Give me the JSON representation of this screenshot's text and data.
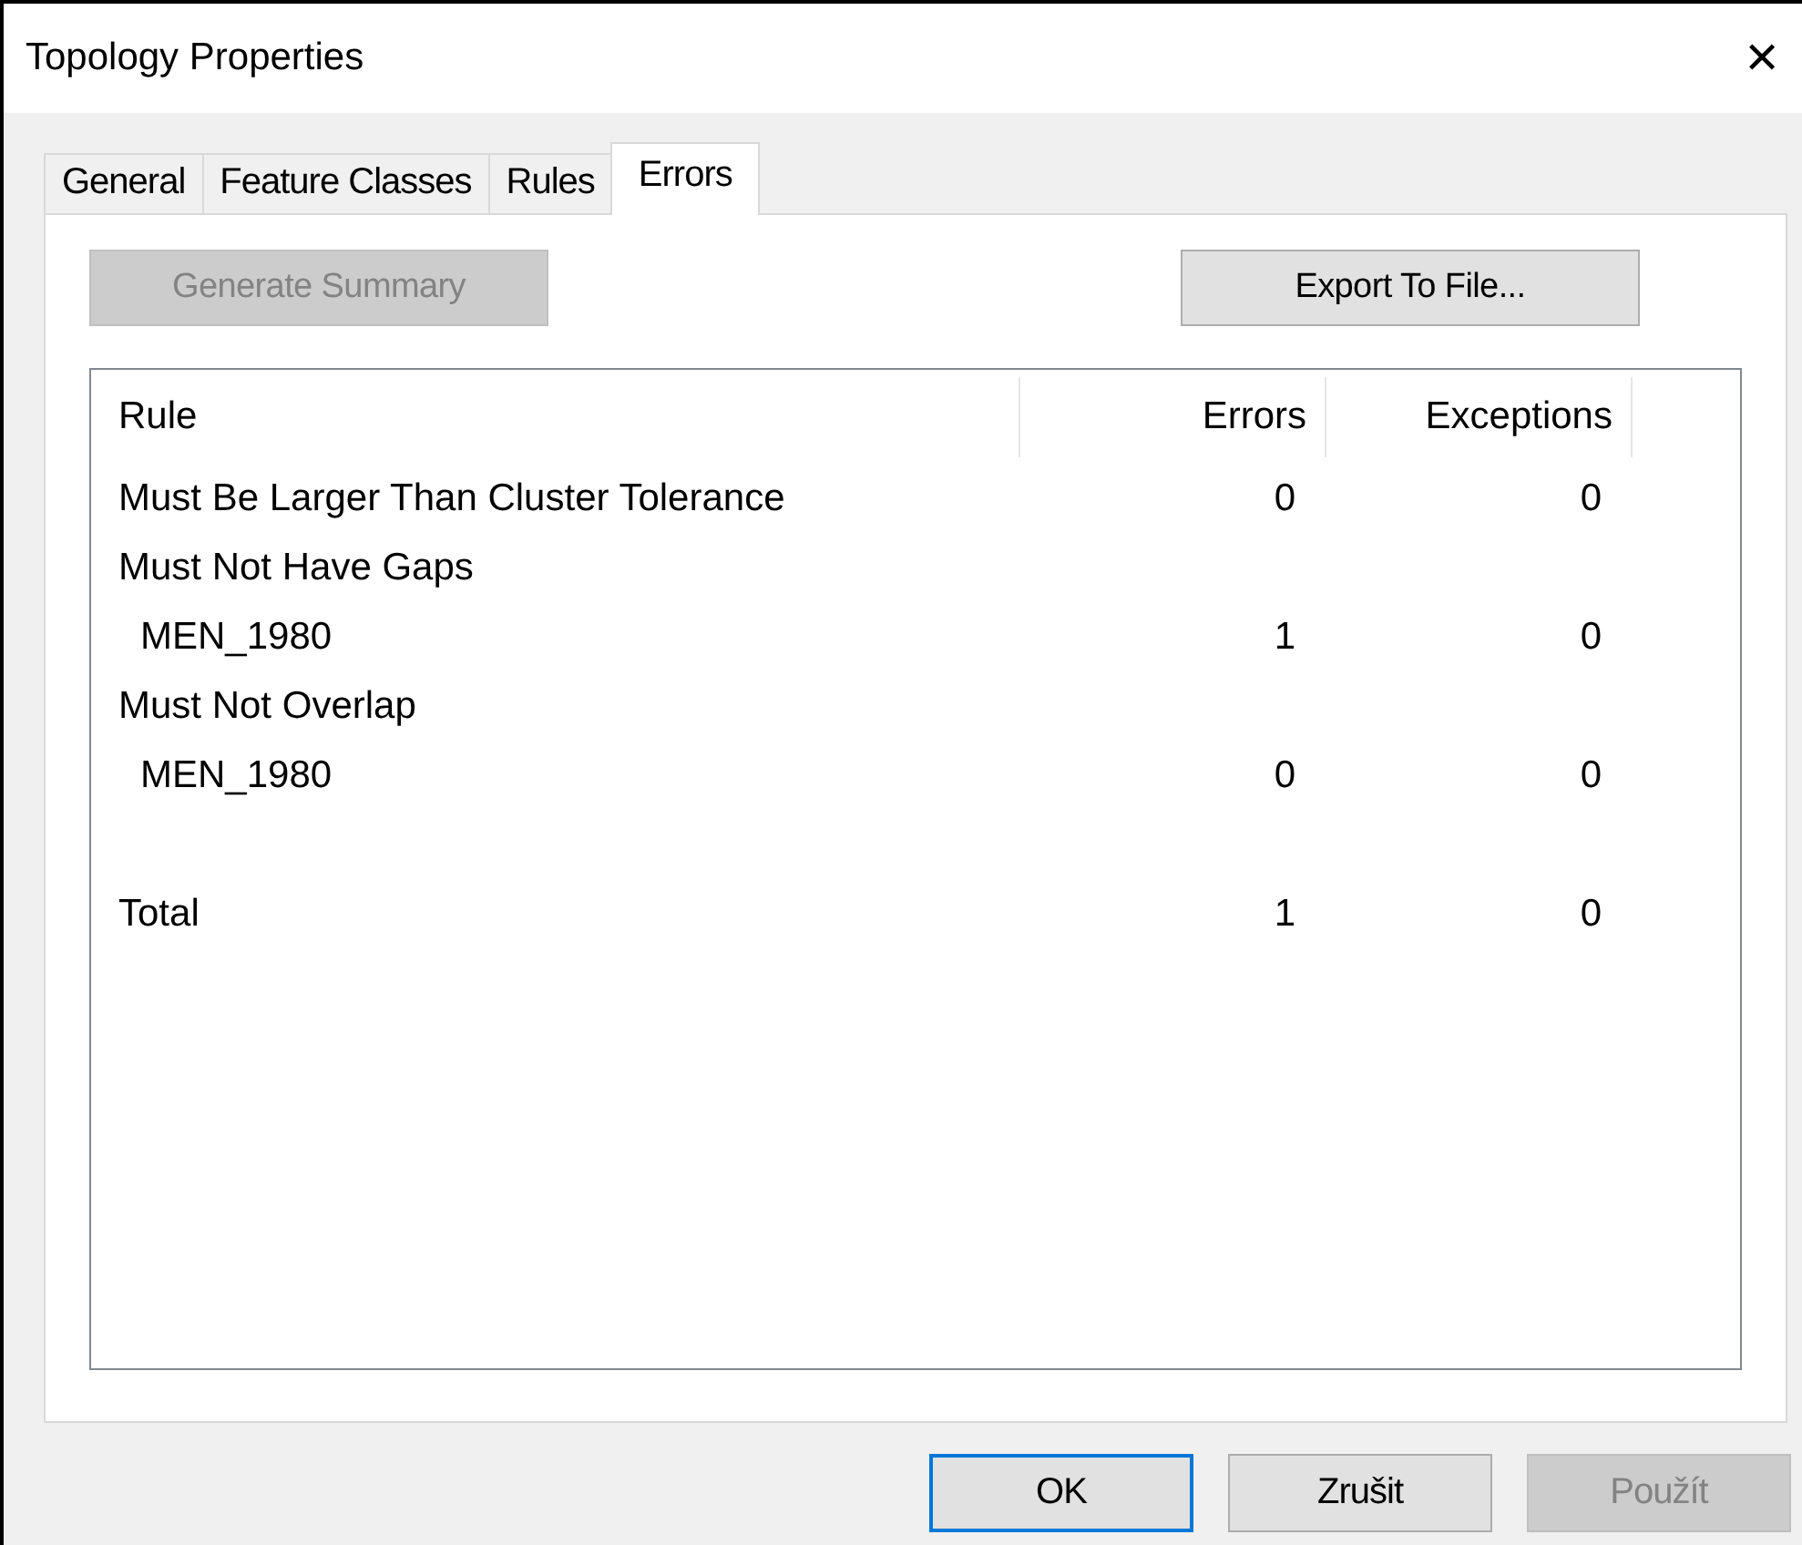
{
  "window": {
    "title": "Topology Properties",
    "close": "✕"
  },
  "tabs": [
    {
      "label": "General",
      "selected": false
    },
    {
      "label": "Feature Classes",
      "selected": false
    },
    {
      "label": "Rules",
      "selected": false
    },
    {
      "label": "Errors",
      "selected": true
    }
  ],
  "toolbar": [
    {
      "label": "Generate Summary",
      "disabled": true
    },
    {
      "label": "Export To File...",
      "disabled": false
    }
  ],
  "table": {
    "columns": [
      "Rule",
      "Errors",
      "Exceptions"
    ],
    "rows": [
      {
        "rule": "Must Be Larger Than Cluster Tolerance",
        "errors": "0",
        "exceptions": "0"
      },
      {
        "rule": "Must Not Have Gaps",
        "children": [
          {
            "rule": "MEN_1980",
            "errors": "1",
            "exceptions": "0"
          }
        ]
      },
      {
        "rule": "Must Not Overlap",
        "children": [
          {
            "rule": "MEN_1980",
            "errors": "0",
            "exceptions": "0"
          }
        ]
      }
    ],
    "total": {
      "rule": "Total",
      "errors": "1",
      "exceptions": "0"
    }
  },
  "buttons": [
    {
      "label": "OK",
      "default": true,
      "disabled": false
    },
    {
      "label": "Zrušit",
      "default": false,
      "disabled": false
    },
    {
      "label": "Použít",
      "default": false,
      "disabled": true
    }
  ]
}
